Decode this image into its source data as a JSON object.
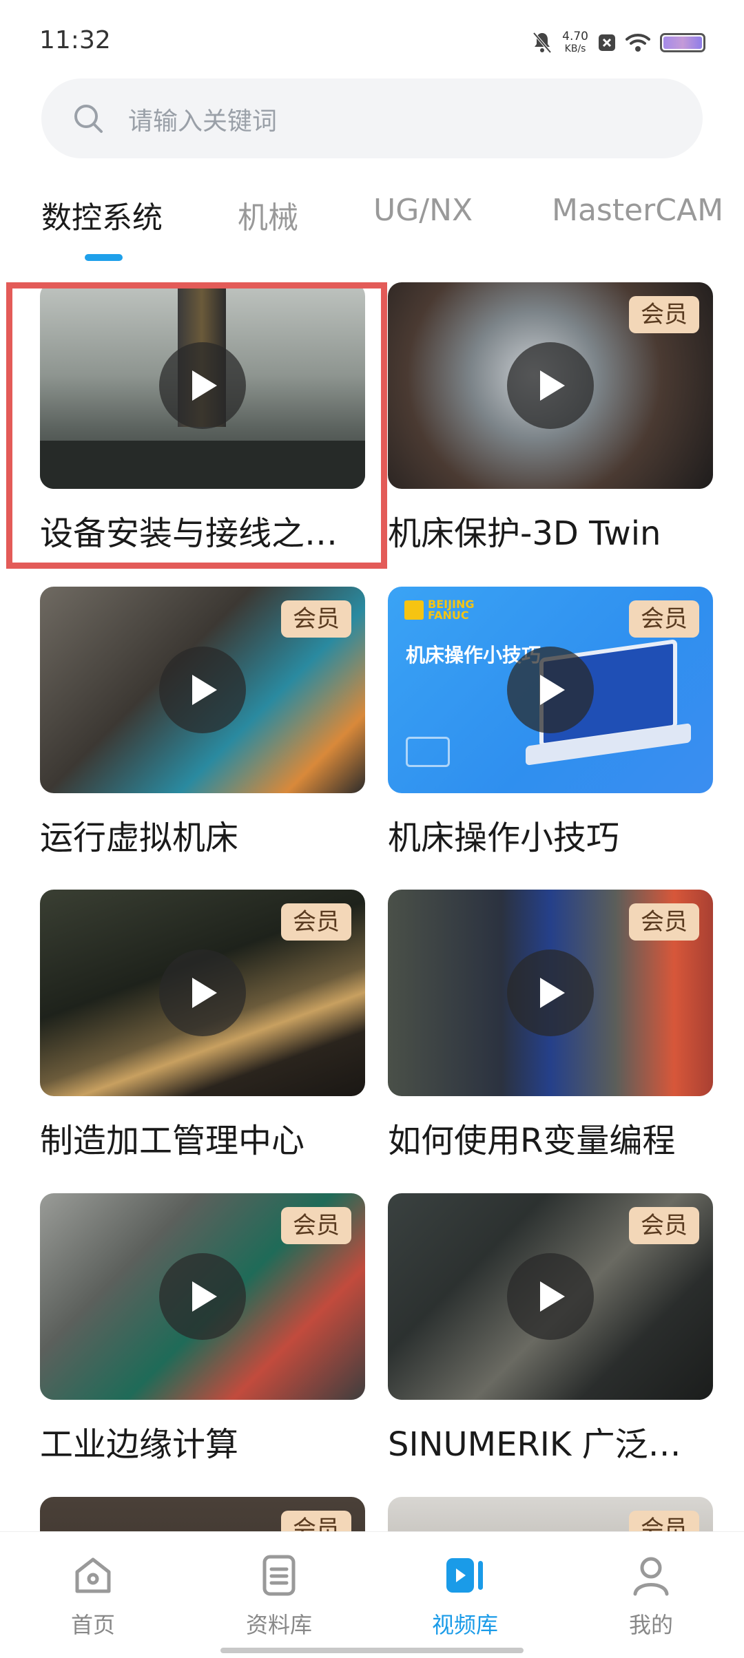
{
  "status_bar": {
    "time": "11:32",
    "net_speed": "4.70",
    "net_unit": "KB/s"
  },
  "search": {
    "placeholder": "请输入关键词"
  },
  "tabs": [
    {
      "label": "数控系统",
      "active": true
    },
    {
      "label": "机械"
    },
    {
      "label": "UG/NX"
    },
    {
      "label": "MasterCAM"
    }
  ],
  "videos": [
    {
      "title": "设备安装与接线之…",
      "badge": ""
    },
    {
      "title": "机床保护-3D Twin",
      "badge": "会员"
    },
    {
      "title": "运行虚拟机床",
      "badge": "会员"
    },
    {
      "title": "机床操作小技巧",
      "badge": "会员",
      "thumb_brand": "BEIJING FANUC",
      "thumb_caption": "机床操作小技巧"
    },
    {
      "title": "制造加工管理中心",
      "badge": "会员"
    },
    {
      "title": "如何使用R变量编程",
      "badge": "会员"
    },
    {
      "title": "工业边缘计算",
      "badge": "会员"
    },
    {
      "title": "SINUMERIK 广泛…",
      "badge": "会员"
    },
    {
      "title": "",
      "badge": "会员"
    },
    {
      "title": "",
      "badge": "会员"
    }
  ],
  "bottom_nav": [
    {
      "label": "首页",
      "icon": "home-icon"
    },
    {
      "label": "资料库",
      "icon": "document-icon"
    },
    {
      "label": "视频库",
      "icon": "video-icon",
      "active": true
    },
    {
      "label": "我的",
      "icon": "profile-icon"
    }
  ],
  "colors": {
    "accent": "#1fa0ea",
    "highlight_border": "#e35b58",
    "vip_badge_bg": "#f3d7b8"
  }
}
